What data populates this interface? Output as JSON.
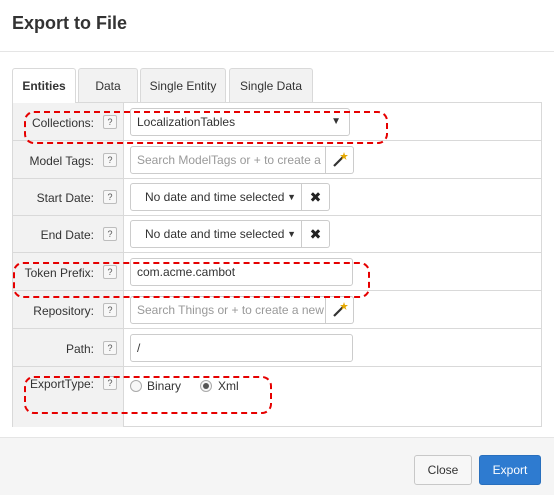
{
  "dialog": {
    "title": "Export to File"
  },
  "tabs": [
    {
      "label": "Entities",
      "active": true
    },
    {
      "label": "Data"
    },
    {
      "label": "Single Entity"
    },
    {
      "label": "Single Data"
    }
  ],
  "form": {
    "help_glyph": "?",
    "collections": {
      "label": "Collections:",
      "value": "LocalizationTables"
    },
    "model_tags": {
      "label": "Model Tags:",
      "placeholder": "Search ModelTags or + to create a"
    },
    "start_date": {
      "label": "Start Date:",
      "value": "No date and time selected",
      "clear_glyph": "✖"
    },
    "end_date": {
      "label": "End Date:",
      "value": "No date and time selected",
      "clear_glyph": "✖"
    },
    "token_prefix": {
      "label": "Token Prefix:",
      "value": "com.acme.cambot"
    },
    "repository": {
      "label": "Repository:",
      "placeholder": "Search Things or + to create a new"
    },
    "path": {
      "label": "Path:",
      "value": "/"
    },
    "export_type": {
      "label": "ExportType:",
      "options": [
        "Binary",
        "Xml"
      ],
      "selected": "Xml"
    }
  },
  "footer": {
    "close_label": "Close",
    "export_label": "Export"
  },
  "colors": {
    "highlight": "#e60000",
    "primary": "#2e7bd0"
  },
  "icons": {
    "caret": "caret-down-icon",
    "wand": "magic-wand-icon",
    "clear": "clear-x-icon"
  }
}
